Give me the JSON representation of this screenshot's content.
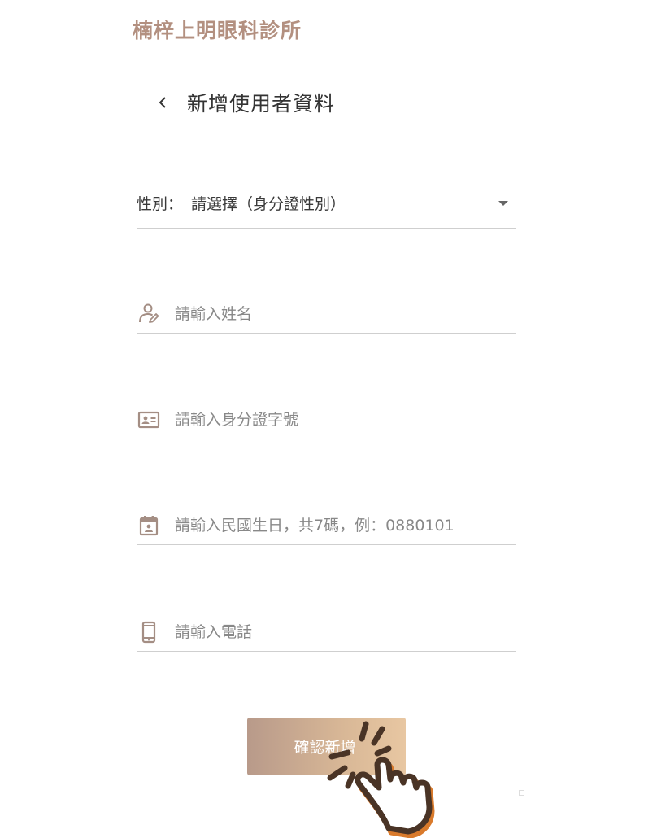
{
  "clinic_name": "楠梓上明眼科診所",
  "header": {
    "title": "新增使用者資料"
  },
  "gender_select": {
    "label": "性別：",
    "value": "請選擇（身分證性別）"
  },
  "fields": {
    "name": {
      "placeholder": "請輸入姓名",
      "icon": "person-edit-icon"
    },
    "id_number": {
      "placeholder": "請輸入身分證字號",
      "icon": "id-card-icon"
    },
    "birthday": {
      "placeholder": "請輸入民國生日，共7碼，例：0880101",
      "icon": "calendar-icon"
    },
    "phone": {
      "placeholder": "請輸入電話",
      "icon": "mobile-phone-icon"
    }
  },
  "submit": {
    "label": "確認新增"
  },
  "colors": {
    "brand": "#b39080",
    "icon": "#a48e84",
    "button_start": "#b89a8a",
    "button_end": "#e8c7a2",
    "hand_outline": "#4a3426",
    "hand_shadow": "#d97a2b"
  }
}
